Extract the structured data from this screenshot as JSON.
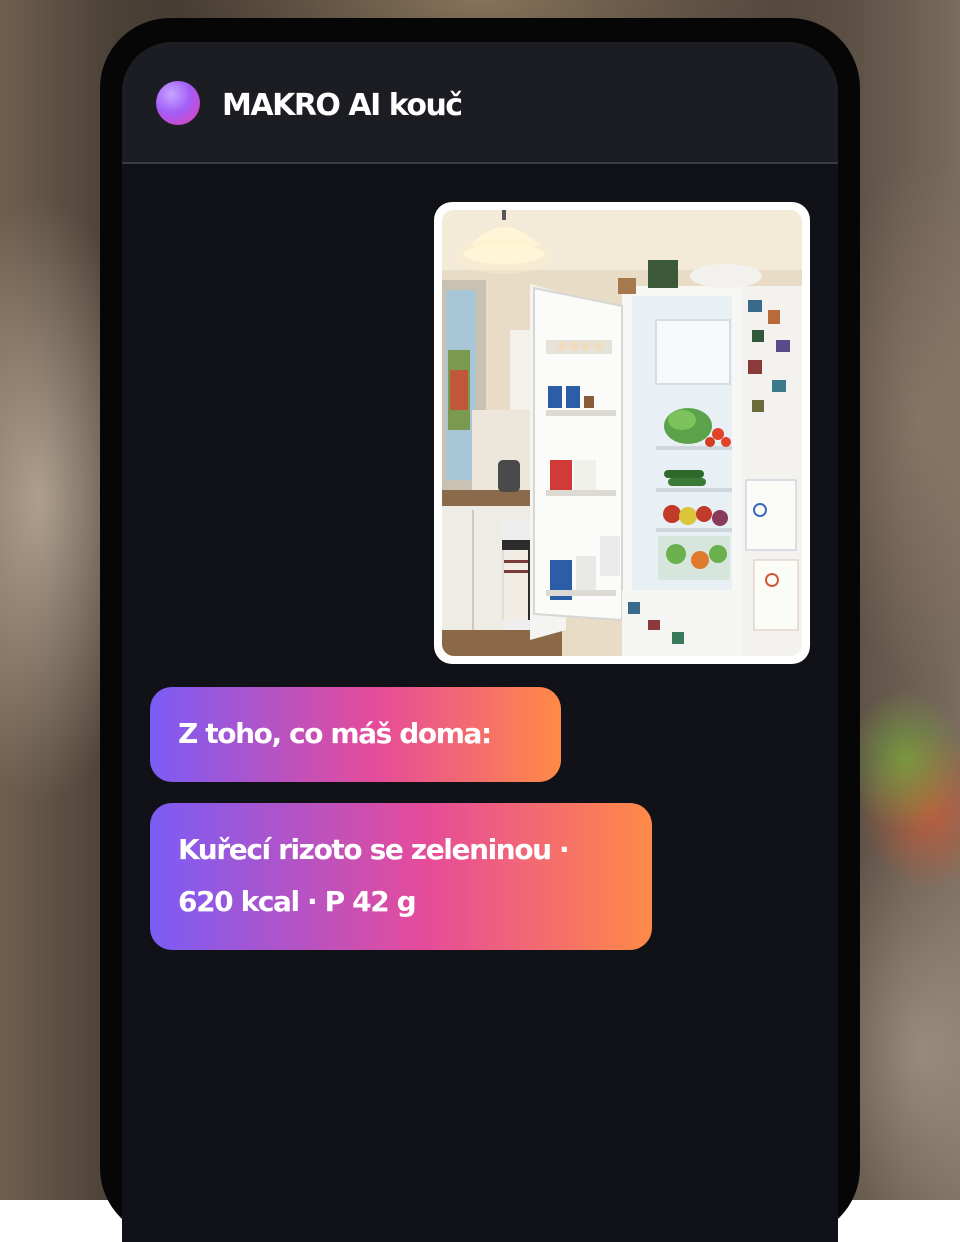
{
  "app": {
    "title": "MAKRO AI kouč",
    "avatar_icon": "gradient-orb-icon"
  },
  "chat": {
    "messages": [
      {
        "role": "user",
        "type": "image",
        "description_icon": "fridge-photo"
      },
      {
        "role": "assistant",
        "type": "text",
        "text": "Z toho, co máš doma:"
      },
      {
        "role": "assistant",
        "type": "text",
        "text": "Kuřecí rizoto se zeleninou · 620 kcal · P 42 g"
      }
    ]
  },
  "colors": {
    "header_bg": "#1c1d23",
    "screen_bg": "#111217",
    "bubble_gradient_start": "#7b5cf6",
    "bubble_gradient_mid": "#e64b9a",
    "bubble_gradient_end": "#ff8a47"
  }
}
